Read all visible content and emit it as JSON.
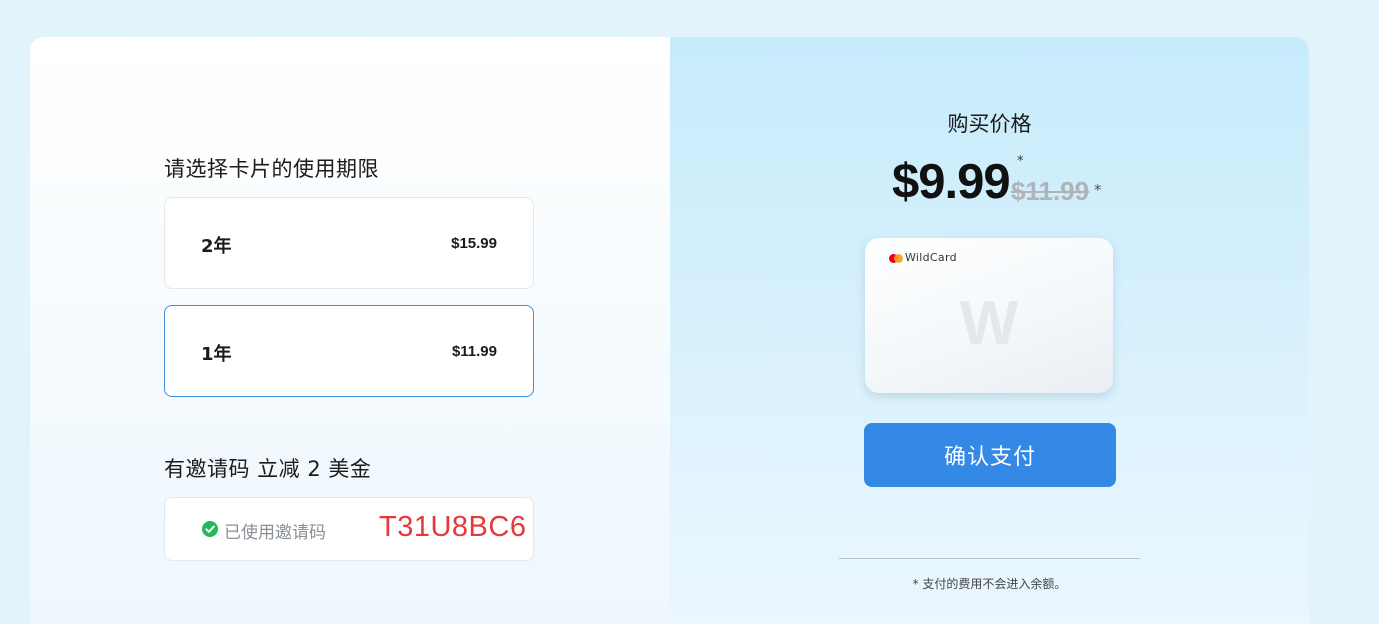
{
  "plan_section": {
    "title": "请选择卡片的使用期限",
    "options": [
      {
        "label": "2年",
        "price": "$15.99"
      },
      {
        "label": "1年",
        "price": "$11.99"
      }
    ],
    "selected_index": 1
  },
  "invite_section": {
    "title": "有邀请码 立减 2 美金",
    "status": "已使用邀请码",
    "code": "T31U8BC6"
  },
  "purchase": {
    "title": "购买价格",
    "current_price": "$9.99",
    "current_price_marker": "*",
    "original_price": "$11.99",
    "original_price_marker": "*"
  },
  "product_card": {
    "brand_icon": "mastercard-logo-icon",
    "brand_name": "WildCard",
    "watermark": "W"
  },
  "pay_button": {
    "label": "确认支付"
  },
  "footnote": "* 支付的费用不会进入余额。",
  "colors": {
    "accent": "#3489e6",
    "selected_border": "#3f8ee0",
    "invite_code": "#e8383b",
    "success": "#22b85b"
  }
}
